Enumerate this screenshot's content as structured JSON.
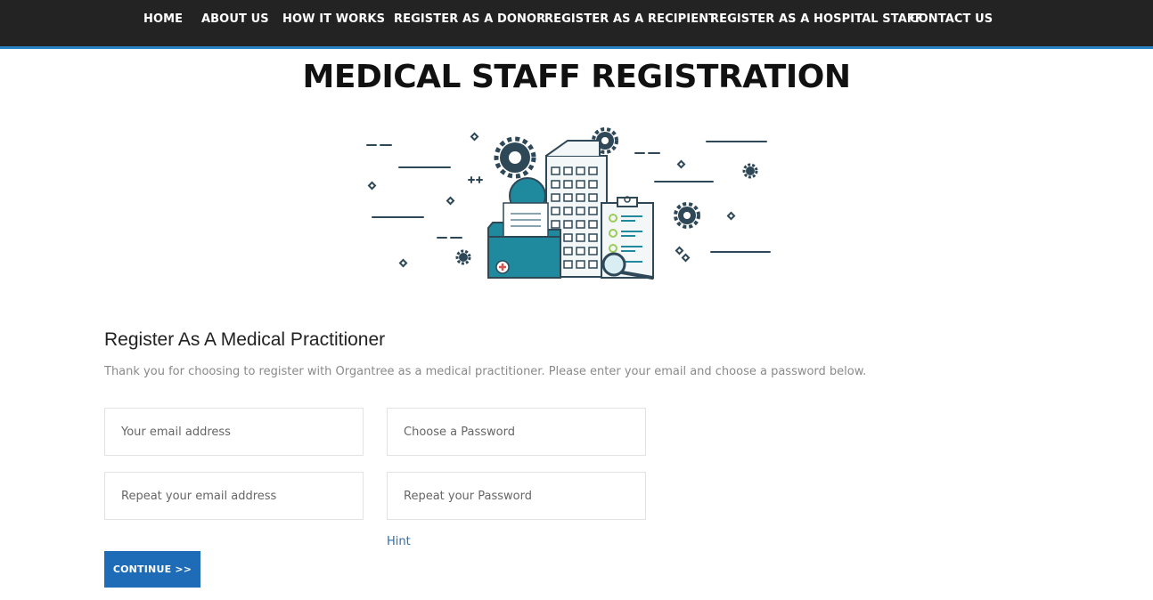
{
  "nav": {
    "items": [
      {
        "label": "HOME"
      },
      {
        "label": "ABOUT US"
      },
      {
        "label": "HOW IT WORKS"
      },
      {
        "label": "REGISTER AS A DONOR"
      },
      {
        "label": "REGISTER AS A RECIPIENT"
      },
      {
        "label": "REGISTER AS A HOSPITAL STAFF"
      },
      {
        "label": "CONTACT US"
      }
    ]
  },
  "page": {
    "title": "MEDICAL STAFF REGISTRATION",
    "hero_icon": "medical-office-illustration"
  },
  "form": {
    "heading": "Register As A Medical Practitioner",
    "intro": "Thank you for choosing to register with Organtree as a medical practitioner. Please enter your email and choose a password below.",
    "email": {
      "placeholder": "Your email address",
      "value": ""
    },
    "password": {
      "placeholder": "Choose a Password",
      "value": ""
    },
    "email_repeat": {
      "placeholder": "Repeat your email address",
      "value": ""
    },
    "password_repeat": {
      "placeholder": "Repeat your Password",
      "value": ""
    },
    "hint_label": "Hint",
    "continue_label": "CONTINUE >>"
  },
  "colors": {
    "nav_bg": "#232323",
    "nav_accent": "#2a83c6",
    "button": "#1e6bb8",
    "illustration_dark": "#2f4858",
    "illustration_teal": "#1f8a9e"
  }
}
